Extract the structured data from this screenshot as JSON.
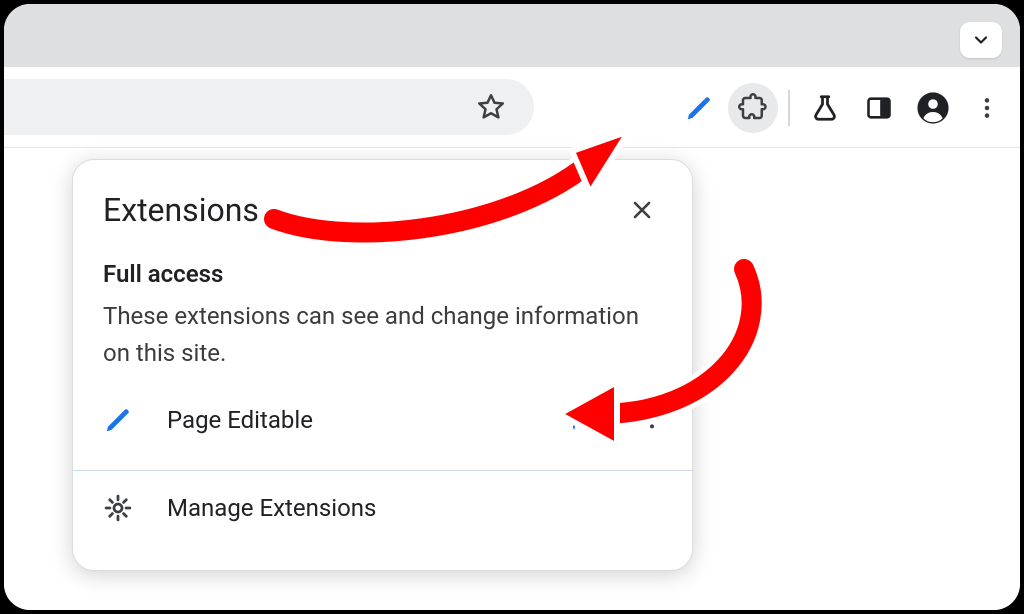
{
  "popup": {
    "title": "Extensions",
    "section_title": "Full access",
    "section_desc": "These extensions can see and change information on this site.",
    "extension_name": "Page Editable",
    "footer_label": "Manage Extensions"
  }
}
